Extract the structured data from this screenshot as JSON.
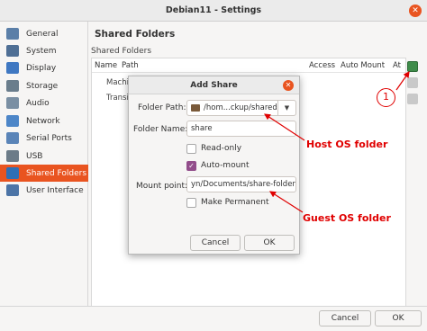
{
  "window": {
    "title": "Debian11 - Settings"
  },
  "sidebar": {
    "items": [
      {
        "label": "General",
        "icon": "general-icon",
        "color": "#5b7fa8"
      },
      {
        "label": "System",
        "icon": "system-icon",
        "color": "#4f6f95"
      },
      {
        "label": "Display",
        "icon": "display-icon",
        "color": "#3f78c2"
      },
      {
        "label": "Storage",
        "icon": "storage-icon",
        "color": "#6a7d8c"
      },
      {
        "label": "Audio",
        "icon": "audio-icon",
        "color": "#7a8fa3"
      },
      {
        "label": "Network",
        "icon": "network-icon",
        "color": "#4d86c8"
      },
      {
        "label": "Serial Ports",
        "icon": "serial-ports-icon",
        "color": "#5a84b8"
      },
      {
        "label": "USB",
        "icon": "usb-icon",
        "color": "#6c7b88"
      },
      {
        "label": "Shared Folders",
        "icon": "shared-folders-icon",
        "color": "#2f6fb5",
        "selected": true
      },
      {
        "label": "User Interface",
        "icon": "user-interface-icon",
        "color": "#4c74a6"
      }
    ]
  },
  "main": {
    "title": "Shared Folders",
    "subtitle": "Shared Folders",
    "columns": {
      "name": "Name",
      "path": "Path",
      "access": "Access",
      "auto_mount": "Auto Mount",
      "at": "At"
    },
    "rows": [
      "Machi",
      "Transi"
    ]
  },
  "dialog": {
    "title": "Add Share",
    "folder_path_label": "Folder Path:",
    "folder_path_value": "/hom...ckup/shared",
    "folder_name_label": "Folder Name:",
    "folder_name_value": "share",
    "read_only_label": "Read-only",
    "read_only_checked": false,
    "auto_mount_label": "Auto-mount",
    "auto_mount_checked": true,
    "mount_point_label": "Mount point:",
    "mount_point_value": "yn/Documents/share-folder",
    "make_permanent_label": "Make Permanent",
    "make_permanent_checked": false,
    "cancel_label": "Cancel",
    "ok_label": "OK"
  },
  "footer": {
    "cancel_label": "Cancel",
    "ok_label": "OK"
  },
  "annotations": {
    "host_os": "Host OS folder",
    "guest_os": "Guest OS folder",
    "marker": "1",
    "color": "#e00000"
  },
  "colors": {
    "accent": "#e95420",
    "checkbox": "#924d8b"
  }
}
